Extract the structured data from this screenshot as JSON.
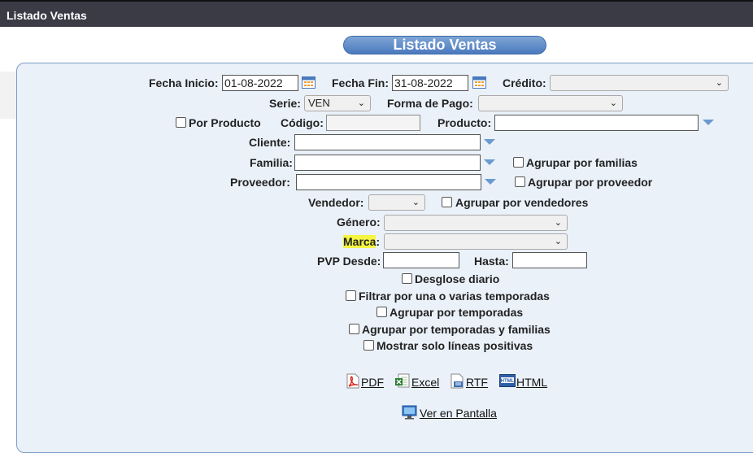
{
  "window": {
    "title": "Listado Ventas"
  },
  "header": {
    "title": "Listado Ventas"
  },
  "form": {
    "fecha_inicio": {
      "label": "Fecha Inicio:",
      "value": "01-08-2022"
    },
    "fecha_fin": {
      "label": "Fecha Fin:",
      "value": "31-08-2022"
    },
    "credito": {
      "label": "Crédito:",
      "value": ""
    },
    "serie": {
      "label": "Serie:",
      "value": "VEN"
    },
    "forma_pago": {
      "label": "Forma de Pago:",
      "value": ""
    },
    "por_producto": {
      "label": "Por Producto"
    },
    "codigo": {
      "label": "Código:",
      "value": ""
    },
    "producto": {
      "label": "Producto:",
      "value": ""
    },
    "cliente": {
      "label": "Cliente:",
      "value": ""
    },
    "familia": {
      "label": "Familia:",
      "value": ""
    },
    "agrupar_familias": {
      "label": "Agrupar por familias"
    },
    "proveedor": {
      "label": "Proveedor:",
      "value": ""
    },
    "agrupar_proveedor": {
      "label": "Agrupar por proveedor"
    },
    "vendedor": {
      "label": "Vendedor:",
      "value": ""
    },
    "agrupar_vendedores": {
      "label": "Agrupar por vendedores"
    },
    "genero": {
      "label": "Género:",
      "value": ""
    },
    "marca": {
      "label": "Marca",
      "colon": ":",
      "value": ""
    },
    "pvp_desde": {
      "label": "PVP Desde:",
      "value": ""
    },
    "hasta": {
      "label": "Hasta:",
      "value": ""
    },
    "desglose_diario": {
      "label": "Desglose diario"
    },
    "filtrar_temporadas": {
      "label": "Filtrar por una o varias temporadas"
    },
    "agrupar_temporadas": {
      "label": "Agrupar por temporadas"
    },
    "agrupar_temporadas_familias": {
      "label": "Agrupar por temporadas y familias"
    },
    "solo_positivas": {
      "label": "Mostrar solo líneas positivas"
    }
  },
  "exports": {
    "pdf": "PDF",
    "excel": "Excel",
    "rtf": "RTF",
    "html": "HTML"
  },
  "ver_pantalla": "Ver en Pantalla",
  "icons": {
    "calendar": "calendar-icon",
    "dropdown": "triangle-down-icon",
    "pdf": "pdf-icon",
    "excel": "excel-icon",
    "rtf": "rtf-icon",
    "html": "html-icon",
    "monitor": "monitor-icon"
  },
  "colors": {
    "title_bar": "#3b3b46",
    "panel_bg": "#eaf1f9",
    "pill": "#4a79bd",
    "highlight": "#f5f542"
  }
}
